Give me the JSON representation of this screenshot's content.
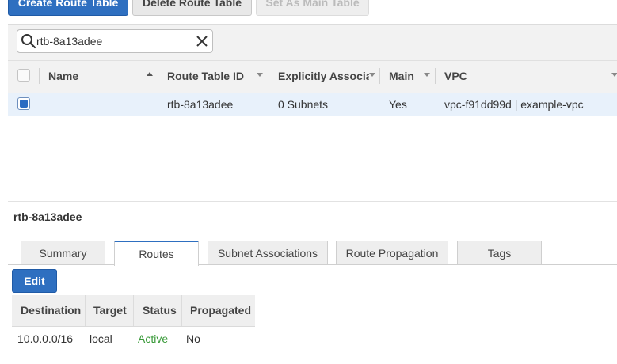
{
  "toolbar": {
    "create_label": "Create Route Table",
    "delete_label": "Delete Route Table",
    "set_main_label": "Set As Main Table"
  },
  "search": {
    "value": "rtb-8a13adee",
    "placeholder": ""
  },
  "table": {
    "columns": [
      "Name",
      "Route Table ID",
      "Explicitly Associat",
      "Main",
      "VPC"
    ],
    "rows": [
      {
        "name": "",
        "route_table_id": "rtb-8a13adee",
        "explicitly_associated": "0 Subnets",
        "main": "Yes",
        "vpc": "vpc-f91dd99d | example-vpc"
      }
    ]
  },
  "detail": {
    "title": "rtb-8a13adee",
    "tabs": [
      "Summary",
      "Routes",
      "Subnet Associations",
      "Route Propagation",
      "Tags"
    ],
    "active_tab": "Routes",
    "edit_label": "Edit",
    "routes": {
      "columns": [
        "Destination",
        "Target",
        "Status",
        "Propagated"
      ],
      "rows": [
        {
          "destination": "10.0.0.0/16",
          "target": "local",
          "status": "Active",
          "propagated": "No"
        }
      ]
    }
  },
  "colors": {
    "primary": "#2e6fc0",
    "status_active": "#3a9a3a",
    "selected_row": "#e8f1fb"
  }
}
